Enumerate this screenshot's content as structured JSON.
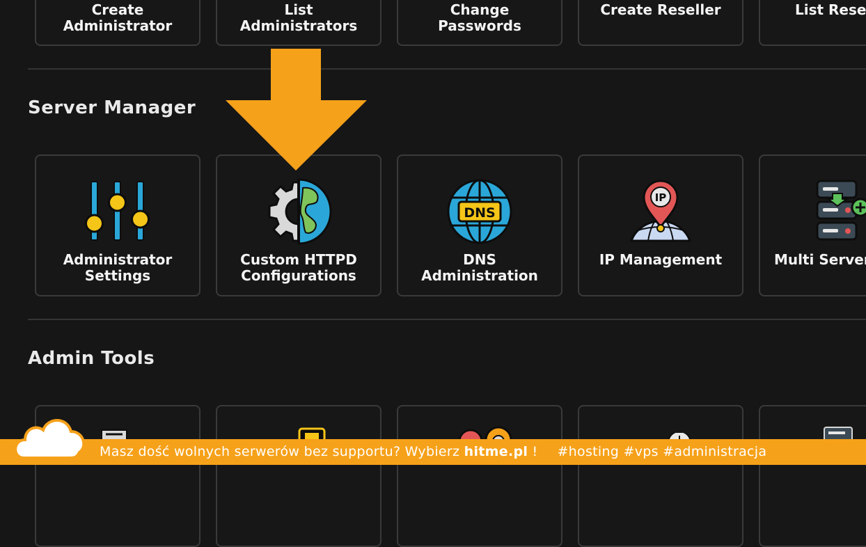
{
  "top_row": [
    {
      "label": "Create\nAdministrator"
    },
    {
      "label": "List\nAdministrators"
    },
    {
      "label": "Change\nPasswords"
    },
    {
      "label": "Create Reseller"
    },
    {
      "label": "List Resell"
    }
  ],
  "server_manager": {
    "title": "Server Manager",
    "items": [
      {
        "label": "Administrator\nSettings",
        "icon": "sliders-icon"
      },
      {
        "label": "Custom HTTPD\nConfigurations",
        "icon": "gear-globe-icon"
      },
      {
        "label": "DNS\nAdministration",
        "icon": "dns-globe-icon"
      },
      {
        "label": "IP Management",
        "icon": "ip-location-pin-icon"
      },
      {
        "label": "Multi Server",
        "icon": "server-add-icon"
      }
    ]
  },
  "admin_tools": {
    "title": "Admin Tools"
  },
  "banner": {
    "prefix": "Masz dość wolnych serwerów bez supportu? Wybierz ",
    "brand": "hitme.pl",
    "suffix": " !",
    "tags": "#hosting #vps #administracja"
  },
  "colors": {
    "background": "#161616",
    "tile_border": "#3a3a3a",
    "arrow": "#f6a11a",
    "banner": "#f6a11a",
    "icon_blue": "#2aa7d8",
    "icon_yellow": "#f5c518"
  }
}
